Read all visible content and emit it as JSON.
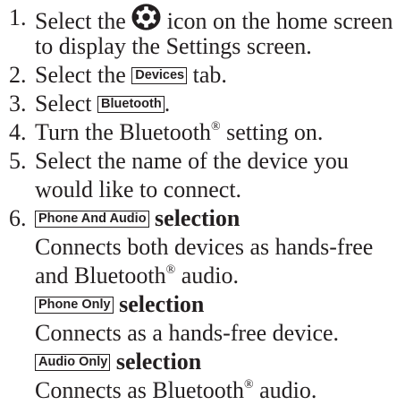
{
  "steps": [
    {
      "num": "1.",
      "lines": [
        {
          "before": "Select the",
          "icon": "settings-gear-icon",
          "after": "icon on the home screen"
        },
        {
          "text": "to display the Settings screen."
        }
      ]
    },
    {
      "num": "2.",
      "before": "Select the",
      "button": "Devices",
      "after": "tab."
    },
    {
      "num": "3.",
      "before": "Select",
      "button": "Bluetooth",
      "after": "."
    },
    {
      "num": "4.",
      "before": "Turn the Bluetooth",
      "sup": "®",
      "after": "setting on."
    },
    {
      "num": "5.",
      "lines": [
        {
          "text": "Select the name of the device you"
        },
        {
          "text": "would like to connect."
        }
      ]
    },
    {
      "num": "6.",
      "options": [
        {
          "button": "Phone And Audio",
          "label": "selection",
          "desc_lines": [
            "Connects both devices as hands-free",
            "and Bluetooth"
          ],
          "desc_sup": "®",
          "desc_end": "audio."
        },
        {
          "button": "Phone Only",
          "label": "selection",
          "desc": "Connects as a hands-free device."
        },
        {
          "button": "Audio Only",
          "label": "selection",
          "desc_before": "Connects as Bluetooth",
          "desc_sup": "®",
          "desc_end": "audio."
        }
      ]
    }
  ]
}
